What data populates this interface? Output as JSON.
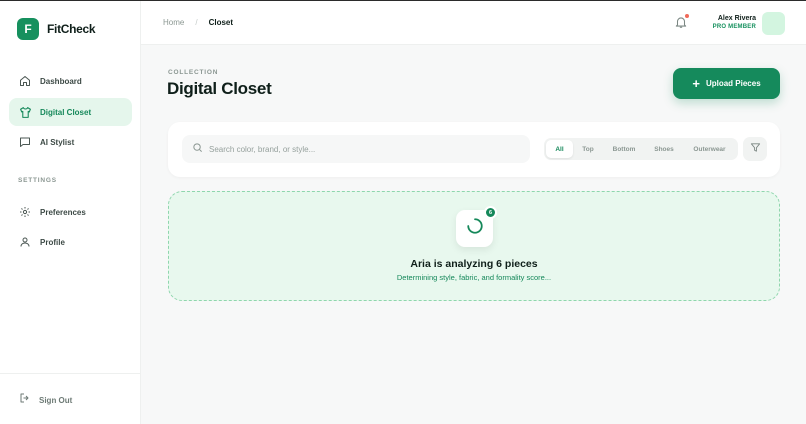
{
  "app": {
    "logo_letter": "F",
    "name": "FitCheck"
  },
  "sidebar": {
    "items": [
      {
        "label": "Dashboard",
        "icon": "home-icon"
      },
      {
        "label": "Digital Closet",
        "icon": "shirt-icon",
        "active": true
      },
      {
        "label": "AI Stylist",
        "icon": "chat-icon"
      }
    ],
    "settings_label": "SETTINGS",
    "settings_items": [
      {
        "label": "Preferences",
        "icon": "gear-icon"
      },
      {
        "label": "Profile",
        "icon": "user-icon"
      }
    ],
    "sign_out": "Sign Out"
  },
  "header": {
    "breadcrumb": {
      "home": "Home",
      "sep": "/",
      "current": "Closet"
    },
    "user": {
      "name": "Alex Rivera",
      "role": "PRO MEMBER"
    }
  },
  "main": {
    "overline": "COLLECTION",
    "title": "Digital Closet",
    "upload_button": {
      "plus": "+",
      "label": "Upload Pieces"
    },
    "search": {
      "placeholder": "Search color, brand, or style..."
    },
    "filters": [
      "All",
      "Top",
      "Bottom",
      "Shoes",
      "Outerwear"
    ],
    "active_filter": "All",
    "analysis": {
      "badge_count": "6",
      "title": "Aria is analyzing 6 pieces",
      "subtitle": "Determining style, fabric, and formality score..."
    }
  },
  "colors": {
    "accent": "#15885a",
    "accent_light": "#e5f6ec",
    "analysis_bg": "#e8f8ee",
    "notification_dot": "#f06a5a"
  }
}
